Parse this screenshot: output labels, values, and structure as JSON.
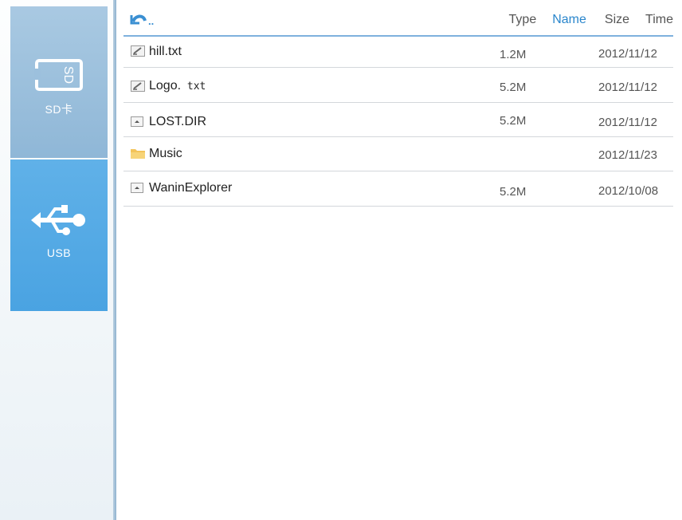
{
  "sidebar": {
    "devices": [
      {
        "label": "SD卡",
        "icon": "sd-card-icon",
        "selected": false
      },
      {
        "label": "USB",
        "icon": "usb-icon",
        "selected": true
      }
    ]
  },
  "toolbar": {
    "back_label": "..",
    "sort_options": [
      "Type",
      "Name",
      "Size",
      "Time"
    ],
    "active_sort": "Name",
    "active_color": "#2a86cc"
  },
  "files": [
    {
      "name_main": "hill.txt",
      "name_ext": "",
      "type_icon": "text-file-icon",
      "size": "1.2M",
      "time": "2012/11/12"
    },
    {
      "name_main": "Logo.",
      "name_ext": " txt",
      "type_icon": "text-file-icon",
      "size": "5.2M",
      "time": "2012/11/12"
    },
    {
      "name_main": "LOST.DIR",
      "name_ext": "",
      "type_icon": "image-file-icon",
      "size": "5.2M",
      "time": "2012/11/12"
    },
    {
      "name_main": "Music",
      "name_ext": "",
      "type_icon": "folder-icon",
      "size": "",
      "time": "2012/11/23"
    },
    {
      "name_main": "WaninExplorer",
      "name_ext": "",
      "type_icon": "image-file-icon",
      "size": "5.2M",
      "time": "2012/10/08"
    }
  ]
}
